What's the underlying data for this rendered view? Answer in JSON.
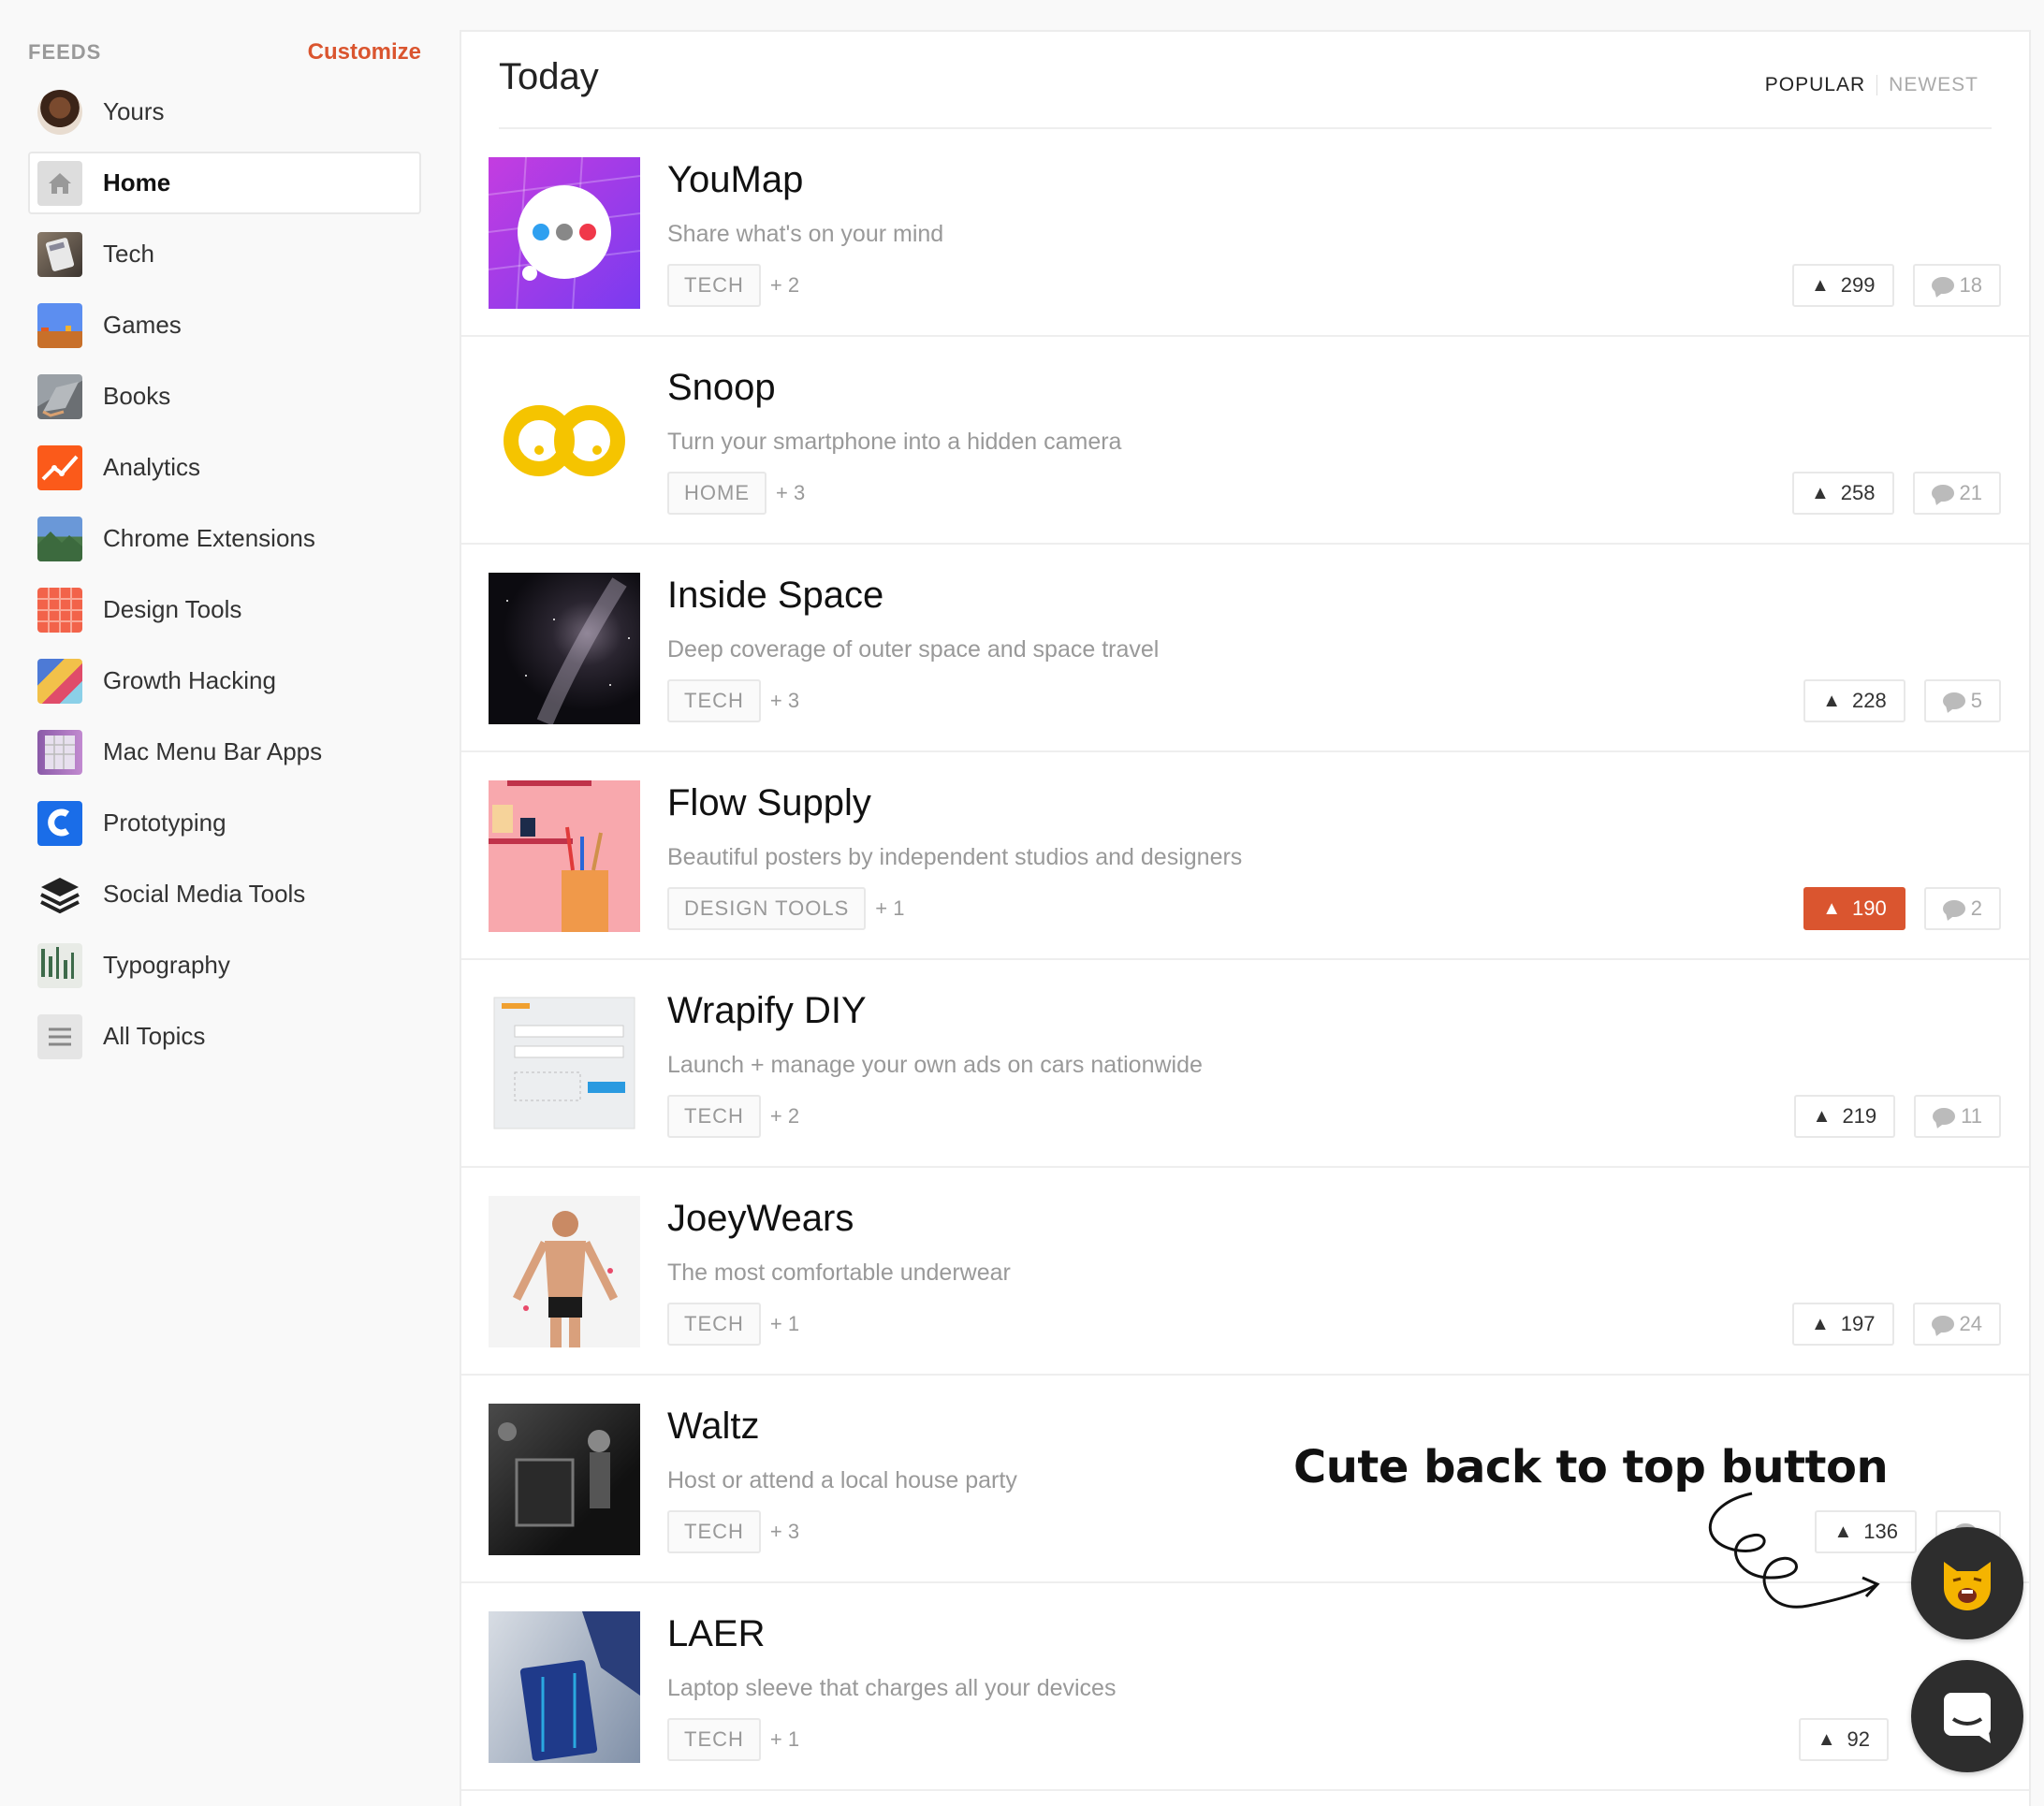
{
  "sidebar": {
    "title": "FEEDS",
    "customize": "Customize",
    "topics": [
      {
        "label": "Yours",
        "icon": "user-avatar-icon"
      },
      {
        "label": "Home",
        "icon": "home-icon",
        "active": true
      },
      {
        "label": "Tech",
        "icon": "calculator-icon"
      },
      {
        "label": "Games",
        "icon": "game-scene-icon"
      },
      {
        "label": "Books",
        "icon": "book-icon"
      },
      {
        "label": "Analytics",
        "icon": "line-chart-icon"
      },
      {
        "label": "Chrome Extensions",
        "icon": "landscape-icon"
      },
      {
        "label": "Design Tools",
        "icon": "grid-icon"
      },
      {
        "label": "Growth Hacking",
        "icon": "collage-icon"
      },
      {
        "label": "Mac Menu Bar Apps",
        "icon": "menu-bar-icon"
      },
      {
        "label": "Prototyping",
        "icon": "prototyping-logo-icon"
      },
      {
        "label": "Social Media Tools",
        "icon": "layers-icon"
      },
      {
        "label": "Typography",
        "icon": "typography-icon"
      },
      {
        "label": "All Topics",
        "icon": "list-icon"
      }
    ]
  },
  "main": {
    "title": "Today",
    "sort": {
      "popular": "POPULAR",
      "newest": "NEWEST"
    },
    "posts": [
      {
        "name": "YouMap",
        "tagline": "Share what's on your mind",
        "tag": "TECH",
        "more": "+ 2",
        "votes": "299",
        "comments": "18",
        "upvoted": false
      },
      {
        "name": "Snoop",
        "tagline": "Turn your smartphone into a hidden camera",
        "tag": "HOME",
        "more": "+ 3",
        "votes": "258",
        "comments": "21",
        "upvoted": false
      },
      {
        "name": "Inside Space",
        "tagline": "Deep coverage of outer space and space travel",
        "tag": "TECH",
        "more": "+ 3",
        "votes": "228",
        "comments": "5",
        "upvoted": false
      },
      {
        "name": "Flow Supply",
        "tagline": "Beautiful posters by independent studios and designers",
        "tag": "DESIGN TOOLS",
        "more": "+ 1",
        "votes": "190",
        "comments": "2",
        "upvoted": true
      },
      {
        "name": "Wrapify DIY",
        "tagline": "Launch + manage your own ads on cars nationwide",
        "tag": "TECH",
        "more": "+ 2",
        "votes": "219",
        "comments": "11",
        "upvoted": false
      },
      {
        "name": "JoeyWears",
        "tagline": "The most comfortable underwear",
        "tag": "TECH",
        "more": "+ 1",
        "votes": "197",
        "comments": "24",
        "upvoted": false
      },
      {
        "name": "Waltz",
        "tagline": "Host or attend a local house party",
        "tag": "TECH",
        "more": "+ 3",
        "votes": "136",
        "comments": "",
        "upvoted": false
      },
      {
        "name": "LAER",
        "tagline": "Laptop sleeve that charges all your devices",
        "tag": "TECH",
        "more": "+ 1",
        "votes": "92",
        "comments": "",
        "upvoted": false
      }
    ]
  },
  "overlay": {
    "annotation": "Cute back to top button",
    "back_to_top_icon": "cat-face-icon",
    "chat_icon": "chat-icon"
  },
  "colors": {
    "accent": "#da552f",
    "background": "#f9f9f9"
  }
}
